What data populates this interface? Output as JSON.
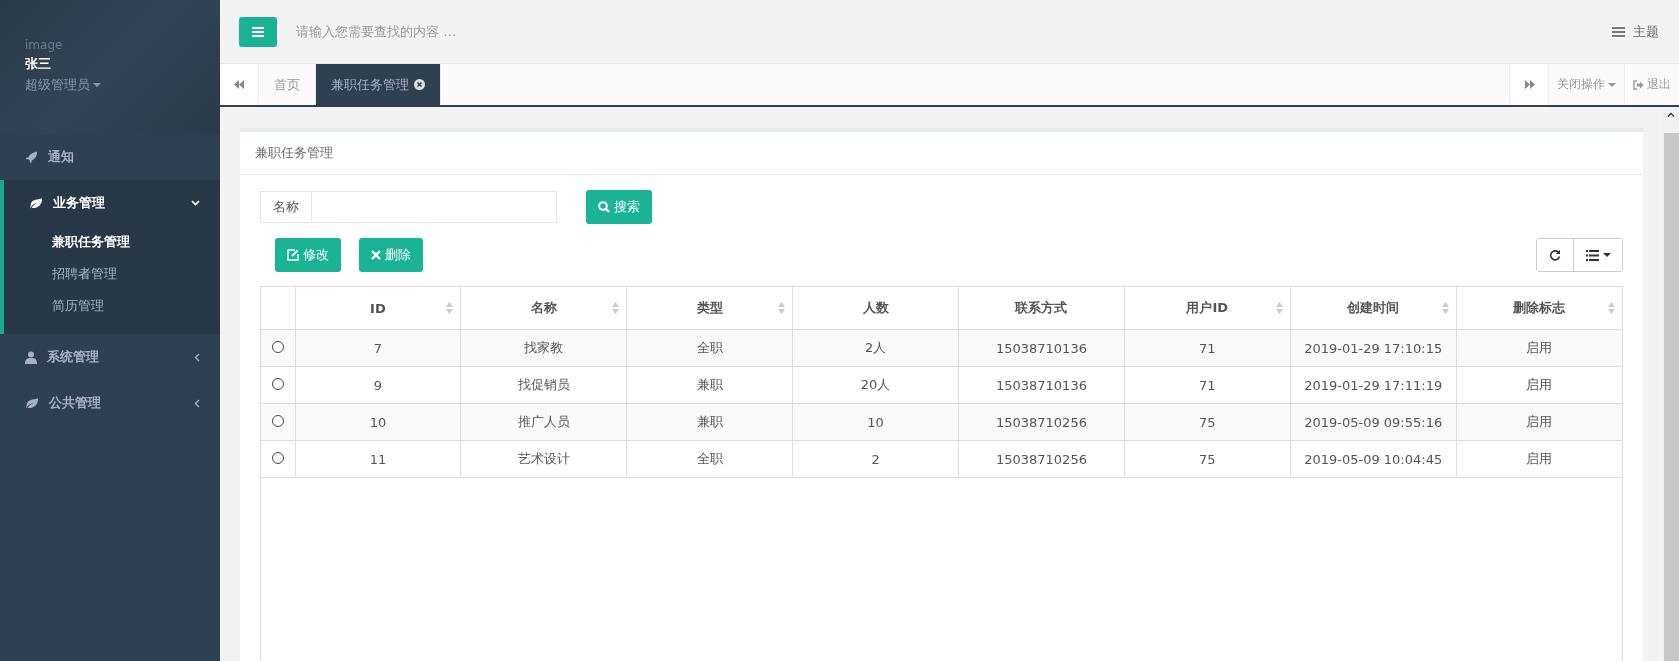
{
  "sidebar": {
    "profile": {
      "image_alt": "image",
      "name": "张三",
      "role": "超级管理员"
    },
    "menu": [
      {
        "label": "通知",
        "expanded": false
      },
      {
        "label": "业务管理",
        "expanded": true,
        "children": [
          {
            "label": "兼职任务管理",
            "selected": true
          },
          {
            "label": "招聘者管理",
            "selected": false
          },
          {
            "label": "简历管理",
            "selected": false
          }
        ]
      },
      {
        "label": "系统管理",
        "expanded": false
      },
      {
        "label": "公共管理",
        "expanded": false
      }
    ]
  },
  "topbar": {
    "search_placeholder": "请输入您需要查找的内容 …",
    "theme_label": "主题"
  },
  "tabbar": {
    "tabs": [
      {
        "label": "首页",
        "selected": false
      },
      {
        "label": "兼职任务管理",
        "selected": true
      }
    ],
    "close_menu": "关闭操作",
    "logout": "退出"
  },
  "panel": {
    "title": "兼职任务管理",
    "search": {
      "label": "名称",
      "button": "搜索"
    },
    "actions": [
      "修改",
      "删除"
    ],
    "table": {
      "columns": [
        {
          "label": "ID",
          "sortable": true
        },
        {
          "label": "名称",
          "sortable": true
        },
        {
          "label": "类型",
          "sortable": true
        },
        {
          "label": "人数",
          "sortable": false
        },
        {
          "label": "联系方式",
          "sortable": false
        },
        {
          "label": "用户ID",
          "sortable": true
        },
        {
          "label": "创建时间",
          "sortable": true
        },
        {
          "label": "删除标志",
          "sortable": true
        }
      ],
      "rows": [
        {
          "selected": false,
          "cells": [
            "7",
            "找家教",
            "全职",
            "2人",
            "15038710136",
            "71",
            "2019-01-29 17:10:15",
            "启用"
          ]
        },
        {
          "selected": false,
          "cells": [
            "9",
            "找促销员",
            "兼职",
            "20人",
            "15038710136",
            "71",
            "2019-01-29 17:11:19",
            "启用"
          ]
        },
        {
          "selected": false,
          "cells": [
            "10",
            "推广人员",
            "兼职",
            "10",
            "15038710256",
            "75",
            "2019-05-09 09:55:16",
            "启用"
          ]
        },
        {
          "selected": false,
          "cells": [
            "11",
            "艺术设计",
            "全职",
            "2",
            "15038710256",
            "75",
            "2019-05-09 10:04:45",
            "启用"
          ]
        }
      ]
    }
  }
}
